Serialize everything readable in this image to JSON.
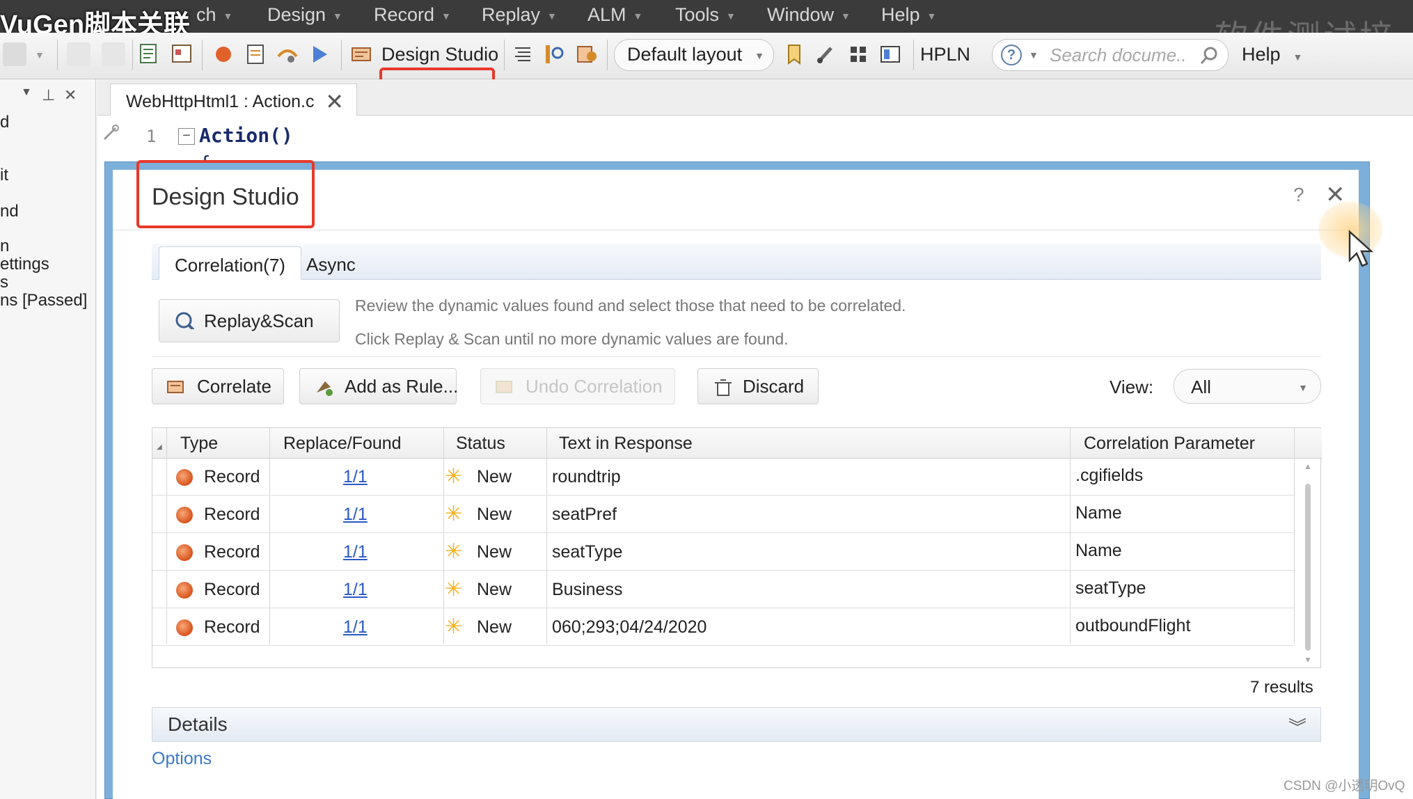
{
  "overlay_title": "VuGen脚本关联",
  "watermark_top": "软件测试培",
  "menubar": {
    "items": [
      "ch",
      "Design",
      "Record",
      "Replay",
      "ALM",
      "Tools",
      "Window",
      "Help"
    ]
  },
  "toolbar": {
    "design_studio": "Design Studio",
    "layout": "Default layout",
    "hpln": "HPLN",
    "search_placeholder": "Search docume...",
    "help": "Help"
  },
  "left_panel": {
    "items": [
      "d",
      "it",
      "nd",
      "n",
      "ettings",
      "s",
      "ns [Passed]"
    ]
  },
  "editor": {
    "tab_title": "WebHttpHtml1 : Action.c",
    "line1_num": "1",
    "line1_code": "Action()",
    "line2_code": "{"
  },
  "dialog": {
    "title": "Design Studio",
    "help_glyph": "?",
    "close_glyph": "✕",
    "tabs": [
      "Correlation(7)",
      "Async"
    ],
    "replay_scan": "Replay&Scan",
    "hint1": "Review the dynamic values found and select those that need to be correlated.",
    "hint2": "Click Replay & Scan until no more dynamic values are found.",
    "buttons": {
      "correlate": "Correlate",
      "add_rule": "Add as Rule...",
      "undo": "Undo Correlation",
      "discard": "Discard"
    },
    "view_label": "View:",
    "view_value": "All",
    "columns": [
      "Type",
      "Replace/Found",
      "Status",
      "Text in Response",
      "Correlation Parameter"
    ],
    "rows": [
      {
        "type": "Record",
        "found": "1/1",
        "status": "New",
        "text": "roundtrip",
        "param": ".cgifields"
      },
      {
        "type": "Record",
        "found": "1/1",
        "status": "New",
        "text": "seatPref",
        "param": "Name"
      },
      {
        "type": "Record",
        "found": "1/1",
        "status": "New",
        "text": "seatType",
        "param": "Name"
      },
      {
        "type": "Record",
        "found": "1/1",
        "status": "New",
        "text": "Business",
        "param": "seatType"
      },
      {
        "type": "Record",
        "found": "1/1",
        "status": "New",
        "text": "060;293;04/24/2020",
        "param": "outboundFlight"
      }
    ],
    "results": "7 results",
    "details": "Details",
    "options": "Options"
  },
  "watermark": "CSDN @小透明OvQ",
  "colors": {
    "menubar": "#3b3b3b",
    "highlight": "#e8392b",
    "dialog_frame": "#7cb0da",
    "link": "#2a58c6",
    "record_dot": "#d8521c",
    "new_star": "#f3b11c"
  }
}
